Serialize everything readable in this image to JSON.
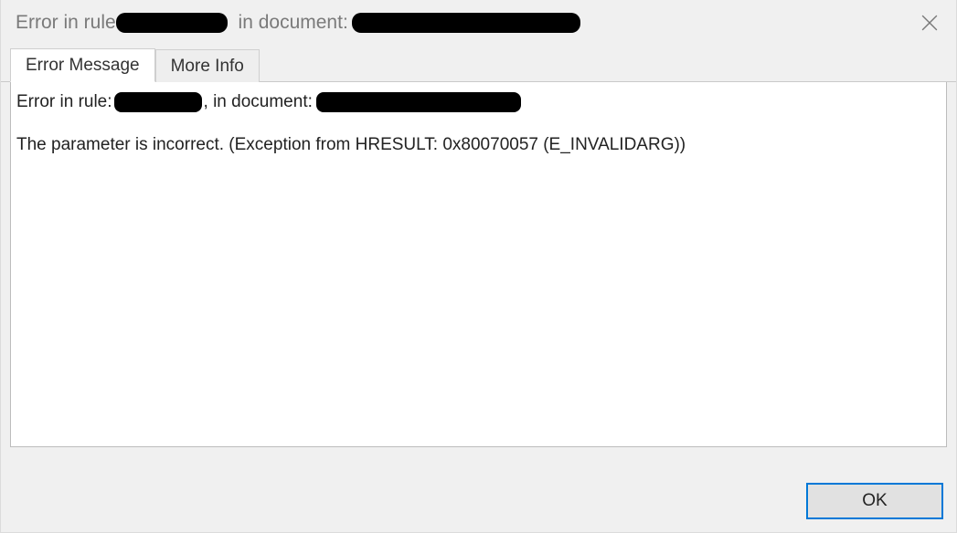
{
  "titlebar": {
    "prefix": "Error in rule",
    "middle": " in document:"
  },
  "tabs": {
    "error_message": "Error Message",
    "more_info": "More Info"
  },
  "content": {
    "line1_prefix": "Error in rule: ",
    "line1_middle": ", in document:",
    "body": "The parameter is incorrect. (Exception from HRESULT: 0x80070057 (E_INVALIDARG))"
  },
  "buttons": {
    "ok": "OK"
  }
}
